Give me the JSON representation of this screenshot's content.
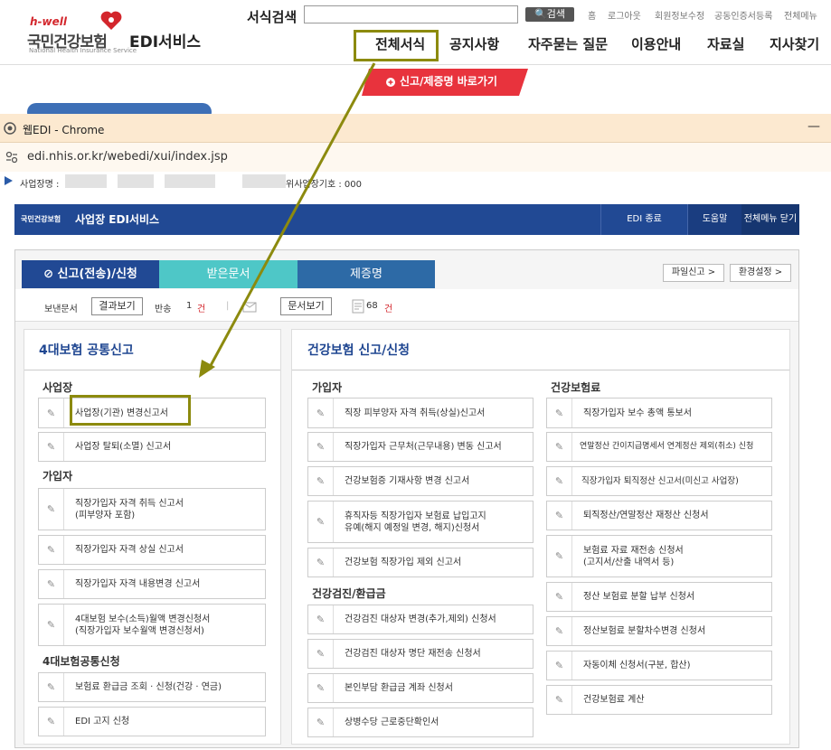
{
  "site": {
    "brand_small": "h-well",
    "brand_main": "국민건강보험",
    "brand_sub": "National Health Insurance Service",
    "brand_edi": "EDI서비스",
    "search_label": "서식검색",
    "search_button": "검색",
    "util_links": [
      "홈",
      "로그아웃",
      "회원정보수정",
      "공동인증서등록",
      "전체메뉴"
    ],
    "nav": [
      "전체서식",
      "공지사항",
      "자주묻는 질문",
      "이용안내",
      "자료실",
      "지사찾기"
    ],
    "shortcut": "신고/제증명 바로가기"
  },
  "chrome": {
    "title": "웹EDI - Chrome",
    "url": "edi.nhis.or.kr/webedi/xui/index.jsp",
    "min": "—"
  },
  "bizbar": {
    "label": "사업장명 :",
    "code": "위사업장기호 : 000"
  },
  "edi": {
    "logo": "국민건강보험",
    "title": "사업장 EDI서비스",
    "end_btn": "EDI 종료",
    "help_btn": "도움말",
    "close_menu_btn": "전체메뉴 닫기"
  },
  "tabs": [
    "신고(전송)/신청",
    "받은문서",
    "제증명"
  ],
  "tab_buttons": [
    "파일신고 >",
    "환경설정 >"
  ],
  "toolbar": {
    "sent": "보낸문서",
    "result_btn": "결과보기",
    "returned": "반송",
    "returned_count": "1",
    "unit": "건",
    "doc_btn": "문서보기",
    "doc_count": "68",
    "unit2": "건"
  },
  "left_panel": {
    "title": "4대보험 공통신고",
    "sections": [
      {
        "name": "사업장",
        "items": [
          "사업장(기관) 변경신고서",
          "사업장 탈퇴(소멸) 신고서"
        ]
      },
      {
        "name": "가입자",
        "items": [
          "직장가입자 자격 취득 신고서\n(피부양자 포함)",
          "직장가입자 자격 상실 신고서",
          "직장가입자 자격 내용변경 신고서",
          "4대보험 보수(소득)월액 변경신청서\n(직장가입자 보수월액 변경신청서)"
        ]
      },
      {
        "name": "4대보험공통신청",
        "items": [
          "보험료 환급금 조회 · 신청(건강 · 연금)",
          "EDI 고지 신청"
        ]
      }
    ]
  },
  "right_panel": {
    "title": "건강보험 신고/신청",
    "col1": [
      {
        "name": "가입자",
        "items": [
          "직장 피부양자 자격 취득(상실)신고서",
          "직장가입자 근무처(근무내용) 변동 신고서",
          "건강보험증 기재사항 변경 신고서",
          "휴직자등 직장가입자 보험료 납입고지\n유예(해지 예정일 변경, 해지)신청서",
          "건강보험 직장가입 제외 신고서"
        ]
      },
      {
        "name": "건강검진/환급금",
        "items": [
          "건강검진 대상자 변경(추가,제외) 신청서",
          "건강검진 대상자 명단 재전송 신청서",
          "본인부담 환급금 계좌 신청서",
          "상병수당 근로중단확인서"
        ]
      }
    ],
    "col2": [
      {
        "name": "건강보험료",
        "items": [
          "직장가입자 보수 총액 통보서",
          "연말정산 간이지급명세서 연계정산 제외(취소) 신청",
          "직장가입자 퇴직정산 신고서(미신고 사업장)",
          "퇴직정산/연말정산 재정산 신청서",
          "보험료 자료 재전송 신청서\n(고지서/산출 내역서 등)",
          "정산 보험료 분할 납부 신청서",
          "정산보험료 분할차수변경 신청서",
          "자동이체 신청서(구분, 합산)",
          "건강보험료 계산"
        ]
      }
    ]
  },
  "colors": {
    "edi_blue": "#214994",
    "tab_active": "#214994",
    "tab_teal": "#4ec7c7",
    "tab_blue": "#2d6aa6",
    "highlight": "#8c8a0e",
    "shortcut_red": "#e8333d"
  }
}
